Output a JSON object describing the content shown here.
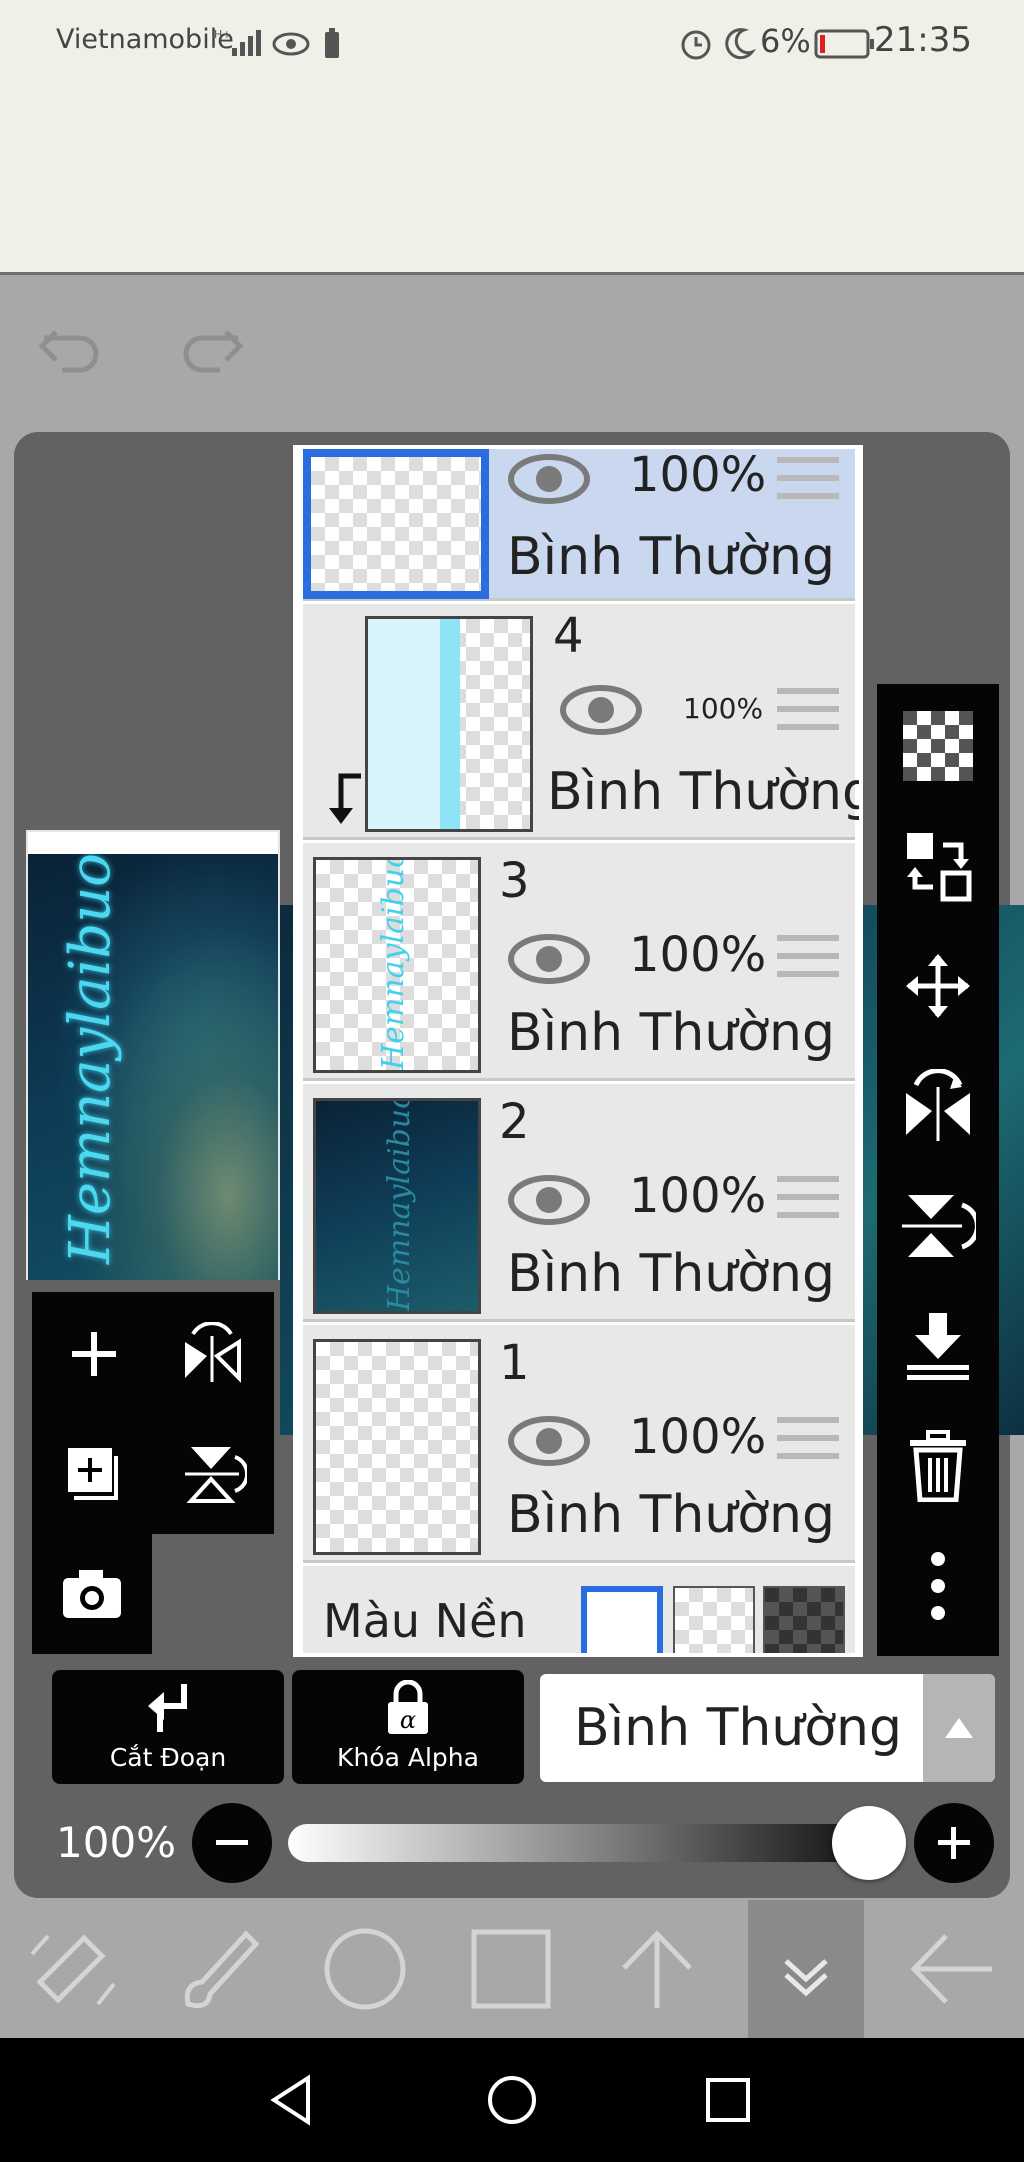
{
  "status": {
    "carrier": "Vietnamobile",
    "battery_pct": "6%",
    "time": "21:35",
    "icons": [
      "signal-icon",
      "eye-icon",
      "battery-saver-icon",
      "alarm-icon",
      "moon-icon",
      "battery-icon"
    ]
  },
  "canvas": {
    "preview_text": "Hemnaylaibuon"
  },
  "layers": [
    {
      "id": "top",
      "number": "",
      "opacity": "100%",
      "blend": "Bình Thường",
      "selected": true
    },
    {
      "id": "4",
      "number": "4",
      "opacity": "100%",
      "blend": "Bình Thường",
      "clipped": true
    },
    {
      "id": "3",
      "number": "3",
      "opacity": "100%",
      "blend": "Bình Thường"
    },
    {
      "id": "2",
      "number": "2",
      "opacity": "100%",
      "blend": "Bình Thường"
    },
    {
      "id": "1",
      "number": "1",
      "opacity": "100%",
      "blend": "Bình Thường"
    }
  ],
  "background": {
    "label": "Màu Nền"
  },
  "actions": {
    "clip_label": "Cắt Đoạn",
    "alpha_lock_label": "Khóa Alpha",
    "blend_mode": "Bình Thường"
  },
  "opacity": {
    "label": "100%",
    "value": 1.0
  },
  "right_toolbar": [
    "checker-icon",
    "transfer-icon",
    "move-icon",
    "flip-horizontal-icon",
    "flip-vertical-icon",
    "merge-down-icon",
    "trash-icon",
    "more-icon"
  ],
  "bottom_toolbar": [
    "transform-icon",
    "brush-icon",
    "ellipse-icon",
    "rectangle-icon",
    "arrow-up-icon",
    "chevron-down-double-icon",
    "back-arrow-icon"
  ],
  "colors": {
    "accent": "#2a6de0",
    "panel": "#626262",
    "selected_layer": "#c9d7ef",
    "text_cyan": "#4ed8f0"
  }
}
